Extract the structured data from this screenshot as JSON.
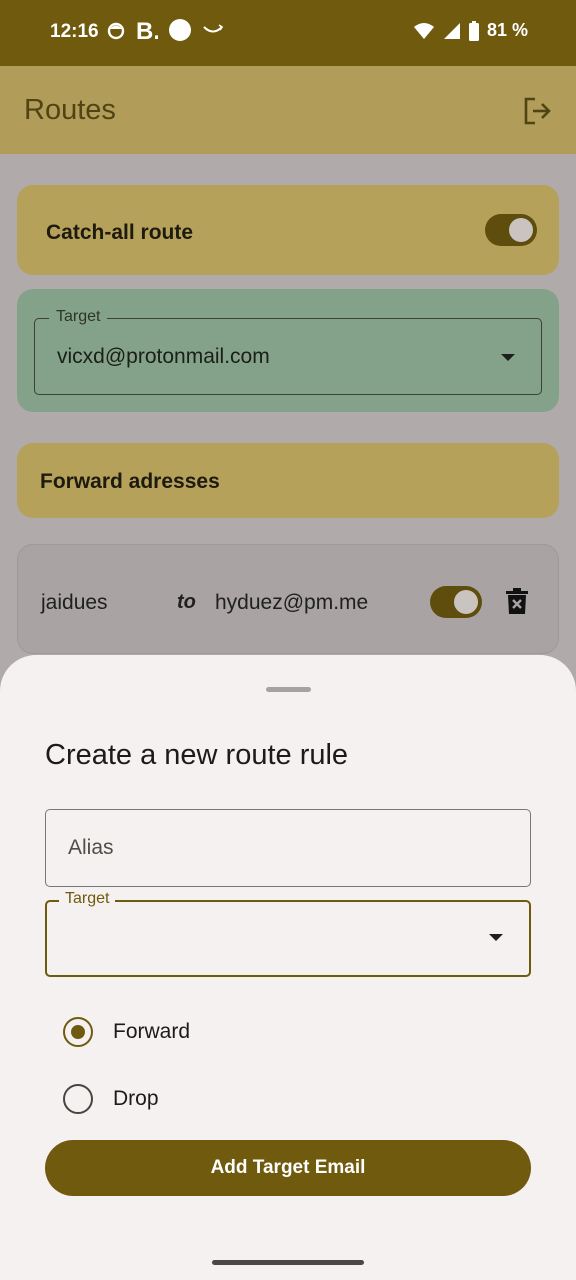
{
  "status_bar": {
    "time": "12:16",
    "battery": "81 %",
    "icons_left": [
      "face-icon",
      "b-icon",
      "circle-icon",
      "smile-icon"
    ],
    "icons_right": [
      "wifi-icon",
      "signal-icon",
      "battery-icon"
    ]
  },
  "app_bar": {
    "title": "Routes",
    "logout_icon": "logout-icon"
  },
  "catch_all": {
    "label": "Catch-all route",
    "enabled": true
  },
  "catch_all_target": {
    "label": "Target",
    "value": "vicxd@protonmail.com"
  },
  "forward_section": {
    "label": "Forward adresses"
  },
  "rules": [
    {
      "alias": "jaidues",
      "connector": "to",
      "target": "hyduez@pm.me",
      "enabled": true
    }
  ],
  "sheet": {
    "title": "Create a new route rule",
    "alias_placeholder": "Alias",
    "target_label": "Target",
    "target_value": "",
    "options": [
      {
        "label": "Forward",
        "selected": true
      },
      {
        "label": "Drop",
        "selected": false
      }
    ],
    "submit_label": "Add Target Email"
  },
  "colors": {
    "primary": "#6f5a0d",
    "surface_card": "#b6a15b",
    "target_card": "#84a28a",
    "sheet_bg": "#f4f1f0"
  }
}
